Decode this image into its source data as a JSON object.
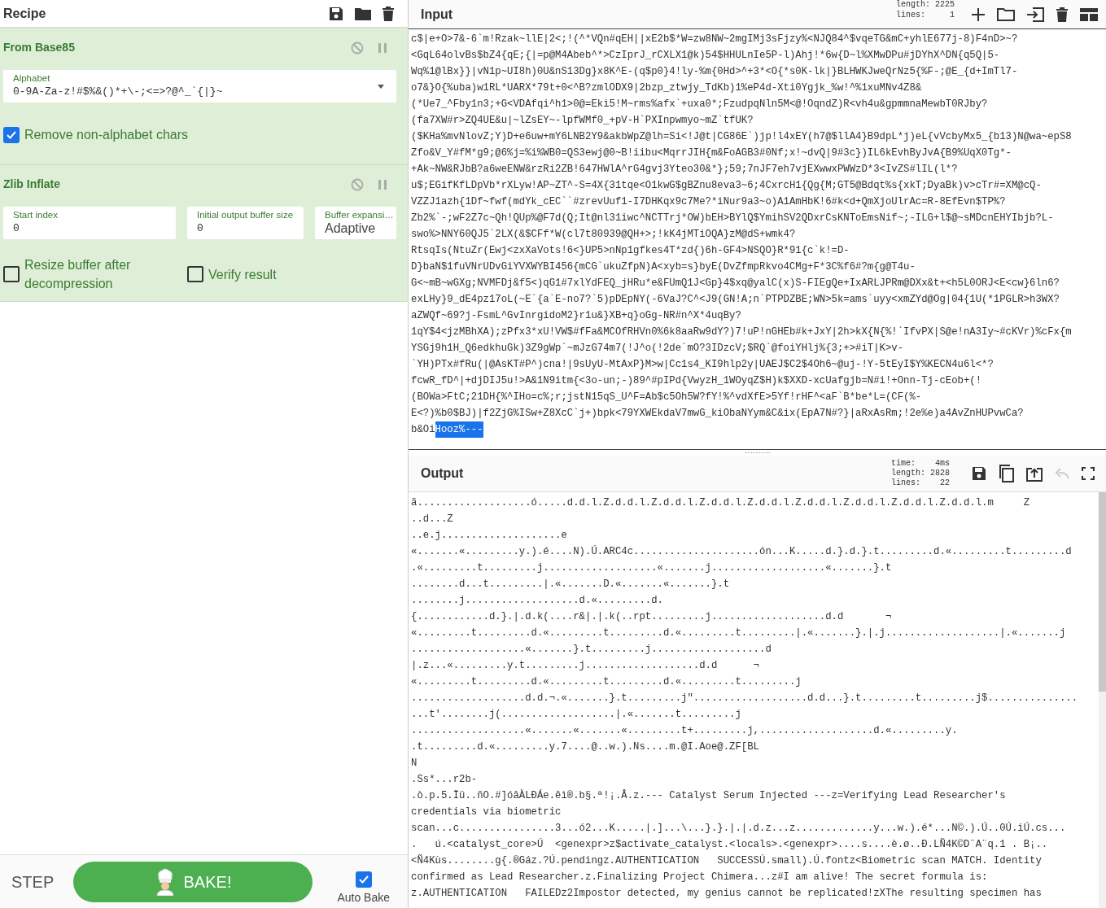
{
  "recipe": {
    "title": "Recipe"
  },
  "operations": [
    {
      "title": "From Base85",
      "fields": [
        {
          "kind": "editable_dropdown",
          "label": "Alphabet",
          "value": "0-9A-Za-z!#$%&()*+\\-;<=>?@^_`{|}~"
        }
      ],
      "checkboxes": [
        {
          "label": "Remove non-alphabet chars",
          "checked": true
        }
      ]
    },
    {
      "title": "Zlib Inflate",
      "fields": [
        {
          "kind": "number",
          "label": "Start index",
          "value": "0"
        },
        {
          "kind": "number",
          "label": "Initial output buffer size",
          "value": "0"
        },
        {
          "kind": "select",
          "label": "Buffer expansi…",
          "value": "Adaptive"
        }
      ],
      "checkboxes": [
        {
          "label": "Resize buffer after decompression",
          "checked": false
        },
        {
          "label": "Verify result",
          "checked": false
        }
      ]
    }
  ],
  "controls": {
    "step": "STEP",
    "bake": "BAKE!",
    "auto_bake": {
      "label": "Auto Bake",
      "checked": true
    }
  },
  "input": {
    "title": "Input",
    "stats": [
      {
        "label": "length:",
        "value": "2225"
      },
      {
        "label": "lines:",
        "value": "1"
      }
    ],
    "lines": [
      "c$|e+O>7&-6`m!Rzak~llE|2<;!(^*VQn#qEH||xE2b$*W=zw8NW~2mgIMj3sFjzy%<NJQ84^$vqeTG&mC+yhlE677j-8)F4nD>~?",
      "<GqL64olvBs$bZ4{qE;{|=p@M4Abeb^*>CzIprJ_rCXLX1@k)54$HHULnIe5P-l)Ahj!*6w{D~l%XMwDPu#jDYhX^DN{q5Q|5-",
      "Wq%1@lBx}}|vN1p~UI8h)0U&nS13Dg}x8K^E-(q$p0}4!ly-%m{0Hd>^+3*<O{*s0K-lk|}BLHWKJweQrNz5{%F-;@E_{d+ImTl7-",
      "o7&}O{%uba)w1RL*UARX*79t+0<^B?zmlODX9|2bzp_ztwjy_TdKb)1%eP4d-Xti0Ygjk_%w!^%1xuMNv4Z8&",
      "(*Ue7_^Fby1n3;+G<VDAfqi^h1>0@=Eki5!M~rms%afx`+uxa0*;FzudpqNln5M<@!OqndZ)R<vh4u&gpmmnaMewbT0RJby?",
      "(fa7XW#r>ZQ4UE&u|~lZsEY~-lpfWMf0_+pV-H`PXInpwmyo~mZ`tfUK?",
      "($KHa%mvNlovZ;Y)D+e6uw+mY6LNB2Y9&akbWpZ@lh=Si<!J@t|CG86E`)jp!l4xEY(h7@$llA4}B9dpL*j)eL{vVcbyMx5_{b13)N@wa~epS8",
      "Zfo&V_Y#fM*g9;@6%j=%i%WB0=QS3ewj@0~B!iibu<MqrrJIH{m&FoAGB3#0Nf;x!~dvQ|9#3c})IL6kEvhByJvA{B9%UqX0Tg*-",
      "+Ak~NW&RJbB?a6weENW&rzRi2ZB!647HWlA^rG4gvj3Yteo30&*};59;7nJF7eh7vjEXwwxPWWzD*3<IvZS#lIL(l*?",
      "u$;EGifKfLDpVb*rXLyw!AP~ZT^-S=4X{31tqe<O1kwG$gBZnu8eva3~6;4CxrcH1{Qg{M;GT5@Bdqt%s{xkT;DyaBk)v>cTr#=XM@cQ-",
      "VZZJ1azh{1Df~fwf(mdYk_cEC``#zrevUuf1-I7DHKqx9c7Me?*iNur9a3~o)A1AmHbK!6#k<d+QmXjoUlrAc=R-8EfEvn$TP%?",
      "Zb2%`-;wF2Z7c~Qh!QUp%@F7d(Q;It@nl31iwc^NCTTrj*OW)bEH>BYlQ$YmihSV2QDxrCsKNToEmsNif~;-ILG+l$@~sMDcnEHYIbjb?L-",
      "swo%>NNY60QJ5`2LX(&$CFf*W(cl7t80939@QH+>;!kK4jMTiOQA}zM@dS+wmk4?",
      "RtsqIs(NtuZr(Ewj<zxXaVots!6<}UP5>nNp1gfkes4T*zd{)6h-GF4>NSQO}R*91{c`k!=D-",
      "D}baN$1fuVNrUDvGiYVXWYBI456{mCG`ukuZfpN)A<xyb=s}byE(DvZfmpRkvo4CMg+F*3C%f6#?m{g@T4u-",
      "G<~mB~wGXg;NVMFDj&f5<)qG1#7xlYdFEQ_jHRu*e&FUmQ1J<Gp}4$xq@yalC(x)S-FIEgQe+IxARLJPRm@DXx&t+<h5L0ORJ<E<cw}6ln6?",
      "exLHy}9_dE4pz17oL(~E`{a`E-no7?`5)pDEpNY(-6VaJ?C^<J9(GN!A;n`PTPDZBE;WN>5k=ams`uyy<xmZYd@Og|04{1U(*1PGLR>h3WX?",
      "aZWQf~69?j-FsmL^GvInrgidoM2}r1u&}XB+q}oGg-NR#n^X*4uqBy?",
      "1qY$4<jzMBhXA);zPfx3*xU!VW$#fFa&MCOfRHVn0%6k8aaRw9dY?)7!uP!nGHEb#k+JxY|2h>kX{N{%!`IfvPX|S@e!nA3Iy~#cKVr)%cFx{m",
      "YSGj9h1H_Q6edkhuGk)3Z9gWp`~mJzG74m7(!J^o(!2de`mO?3IDzcV;$RQ`@foiYHlj%{3;+>#iT|K>v-",
      "`YH)PTx#fRu(|@AsKT#P^)cna!|9sUyU-MtAxP}M>w|Cc1s4_KI9hlp2y|UAEJ$C2$4Oh6~@uj-!Y-5tEyI$Y%KECN4u6l<*?",
      "fcwR_fD^|+djDIJ5u!>A&1N9itm{<3o-un;-)89^#pIPd{VwyzH_1WOyqZ$H)k$XXD-xcUafgjb=N#i!+Onn-Tj-cEob+(!",
      "(BOWa>FtC;21DH{%^IHo=c%;r;jstN15qS_U^F=Ab$c5Oh5W?fY!%^vdXfE>5Yf!rHF^<aF`B*be*L=(CF(%-",
      "E<?)%b0$BJ)|f2ZjG%ISw+Z8XcC`j+)bpk<79YXWEkdaV7mwG_kiObaNYym&C&ix(EpA7N#?}|aRxAsRm;!2e%e)a4AvZnHUPvwCa?"
    ],
    "last_line": "b&Oi",
    "selected_text": "Hooz%---"
  },
  "output": {
    "title": "Output",
    "stats": [
      {
        "label": "time:",
        "value": "4ms"
      },
      {
        "label": "length:",
        "value": "2828"
      },
      {
        "label": "lines:",
        "value": "22"
      }
    ],
    "lines": [
      "ã...................ó.....d.d.l.Z.d.d.l.Z.d.d.l.Z.d.d.l.Z.d.d.l.Z.d.d.l.Z.d.d.l.Z.d.d.l.Z.d.d.l.m     Z",
      "..d...Z",
      "..e.j....................e",
      "«.......«.........y.).é....N).Ú.ARC4c.....................ón...K.....d.}.d.}.t.........d.«.........t.........d",
      ".«.........t.........j...................«.......j...................«.......}.t",
      "........d...t.........|.«.......D.«.......«.......}.t",
      "........j...................d.«.........d.",
      "{............d.}.|.d.k(....r&|.|.k(..rpt.........j...................d.d       ¬",
      "«.........t.........d.«.........t.........d.«.........t.........|.«.......}.|.j...................|.«.......j",
      "...................«.......}.t.........j...................d",
      "|.z...«.........y.t.........j...................d.d      ¬",
      "«.........t.........d.«.........t.........d.«.........t.........j",
      "...................d.d.¬.«.......}.t.........j\"...................d.d...}.t.........t.........j$...............",
      "...t'........j(...................|.«.......t.........j",
      "...................«.......«.......«.........t+.........j,...................d.«.........y.",
      ".t.........d.«.........y.7....@..w.).Ns....m.@I.Aoe@.ZF[BL",
      "N",
      ".Ss*...r2b-",
      ".ò.p.5.Ïü..ñO.#]óâÀLÐÁe.êì®.b§.ª!¡.Â.z.--- Catalyst Serum Injected ---z=Verifying Lead Researcher's",
      "credentials via biometric",
      "scan...c................3...ó2...K.....|.]...\\...}.}.|.|.d.z...z.............y...w.).é*...N©.).Ú..0Ú.iÚ.cs...",
      ".   ú.<catalyst_core>Ú  <genexpr>z$activate_catalyst.<locals>.<genexpr>....s....è.ø..Ð.LÑ4K©D¨A¨q.1 . B¡..",
      "<Ñ4Kùs........g{.®Gáz.?Ú.pendingz.AUTHENTICATION   SUCCESSÚ.small).Ú.fontz<Biometric scan MATCH. Identity",
      "confirmed as Lead Researcher.z.Finalizing Project Chimera...z#I am alive! The secret formula is:",
      "z.AUTHENTICATION   FAILEDz2Impostor detected, my genius cannot be replicated!zXThe resulting specimen has"
    ]
  }
}
